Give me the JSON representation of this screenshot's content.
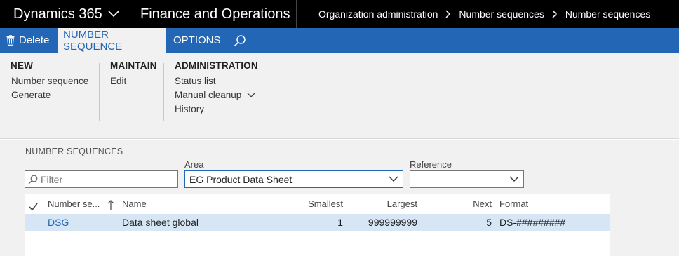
{
  "topbar": {
    "brand": "Dynamics 365",
    "app": "Finance and Operations",
    "breadcrumbs": [
      "Organization administration",
      "Number sequences",
      "Number sequences"
    ]
  },
  "actionpane": {
    "delete_label": "Delete",
    "tabs": [
      {
        "label": "NUMBER SEQUENCE",
        "active": true
      },
      {
        "label": "OPTIONS",
        "active": false
      }
    ]
  },
  "ribbon": {
    "new": {
      "title": "NEW",
      "items": [
        "Number sequence",
        "Generate"
      ]
    },
    "maintain": {
      "title": "MAINTAIN",
      "items": [
        "Edit"
      ]
    },
    "administration": {
      "title": "ADMINISTRATION",
      "items": [
        "Status list",
        "Manual cleanup",
        "History"
      ]
    }
  },
  "content": {
    "section_title": "NUMBER SEQUENCES",
    "filter_placeholder": "Filter",
    "area_label": "Area",
    "area_value": "EG Product Data Sheet",
    "reference_label": "Reference",
    "reference_value": ""
  },
  "grid": {
    "columns": [
      "Number se...",
      "Name",
      "Smallest",
      "Largest",
      "Next",
      "Format"
    ],
    "rows": [
      {
        "code": "DSG",
        "name": "Data sheet global",
        "smallest": "1",
        "largest": "999999999",
        "next": "5",
        "format": "DS-#########"
      }
    ]
  },
  "colors": {
    "topbar_bg": "#000000",
    "accent": "#2266b5",
    "ribbon_bg": "#f1f1f1",
    "selected_row": "#d7e6f5"
  },
  "icons": [
    "chevron-down-icon",
    "chevron-right-icon",
    "trash-icon",
    "search-icon",
    "checkmark-icon",
    "sort-up-arrow-icon"
  ]
}
